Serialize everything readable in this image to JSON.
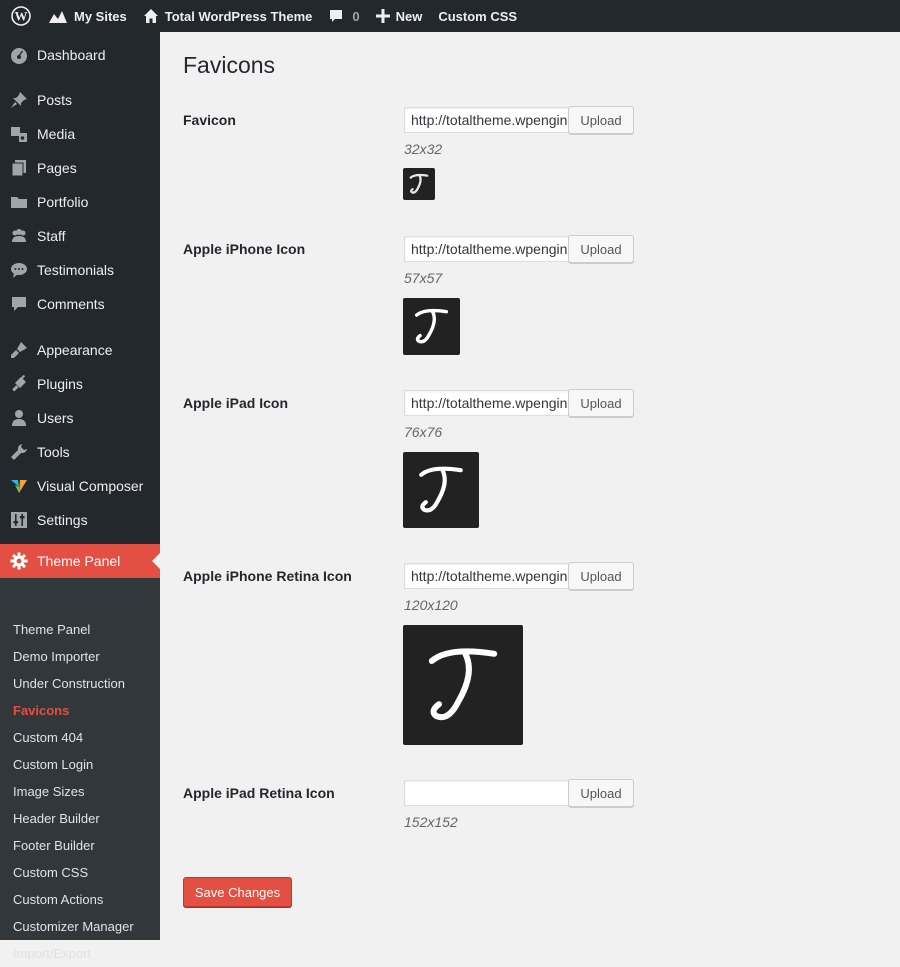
{
  "adminbar": {
    "wp_icon": "wordpress-logo-icon",
    "my_sites": "My Sites",
    "site_name": "Total WordPress Theme",
    "comments_count": "0",
    "new_label": "New",
    "custom_css": "Custom CSS"
  },
  "sidebar": {
    "items": [
      {
        "label": "Dashboard",
        "icon": "dashboard-icon"
      },
      {
        "label": "Posts",
        "icon": "pin-icon"
      },
      {
        "label": "Media",
        "icon": "media-icon"
      },
      {
        "label": "Pages",
        "icon": "pages-icon"
      },
      {
        "label": "Portfolio",
        "icon": "folder-icon"
      },
      {
        "label": "Staff",
        "icon": "people-icon"
      },
      {
        "label": "Testimonials",
        "icon": "speech-bubble-icon"
      },
      {
        "label": "Comments",
        "icon": "comment-icon"
      },
      {
        "label": "Appearance",
        "icon": "brush-icon"
      },
      {
        "label": "Plugins",
        "icon": "plug-icon"
      },
      {
        "label": "Users",
        "icon": "user-icon"
      },
      {
        "label": "Tools",
        "icon": "wrench-icon"
      },
      {
        "label": "Visual Composer",
        "icon": "visual-composer-icon"
      },
      {
        "label": "Settings",
        "icon": "sliders-icon"
      },
      {
        "label": "Theme Panel",
        "icon": "gear-icon"
      }
    ],
    "submenu": [
      "Theme Panel",
      "Demo Importer",
      "Under Construction",
      "Favicons",
      "Custom 404",
      "Custom Login",
      "Image Sizes",
      "Header Builder",
      "Footer Builder",
      "Custom CSS",
      "Custom Actions",
      "Customizer Manager",
      "Import/Export"
    ]
  },
  "page": {
    "title": "Favicons",
    "upload_label": "Upload",
    "save_label": "Save Changes",
    "fields": [
      {
        "label": "Favicon",
        "value": "http://totaltheme.wpengine.com/favicon.png",
        "size": "32x32"
      },
      {
        "label": "Apple iPhone Icon",
        "value": "http://totaltheme.wpengine.com/iphone-icon.png",
        "size": "57x57"
      },
      {
        "label": "Apple iPad Icon",
        "value": "http://totaltheme.wpengine.com/ipad-icon.png",
        "size": "76x76"
      },
      {
        "label": "Apple iPhone Retina Icon",
        "value": "http://totaltheme.wpengine.com/iphone-retina-icon.png",
        "size": "120x120"
      },
      {
        "label": "Apple iPad Retina Icon",
        "value": "",
        "size": "152x152"
      }
    ],
    "preview_glyph": "T",
    "colors": {
      "accent": "#e34f42",
      "sidebar": "#23282d",
      "submenu": "#32373c",
      "preview_bg": "#222222"
    }
  }
}
